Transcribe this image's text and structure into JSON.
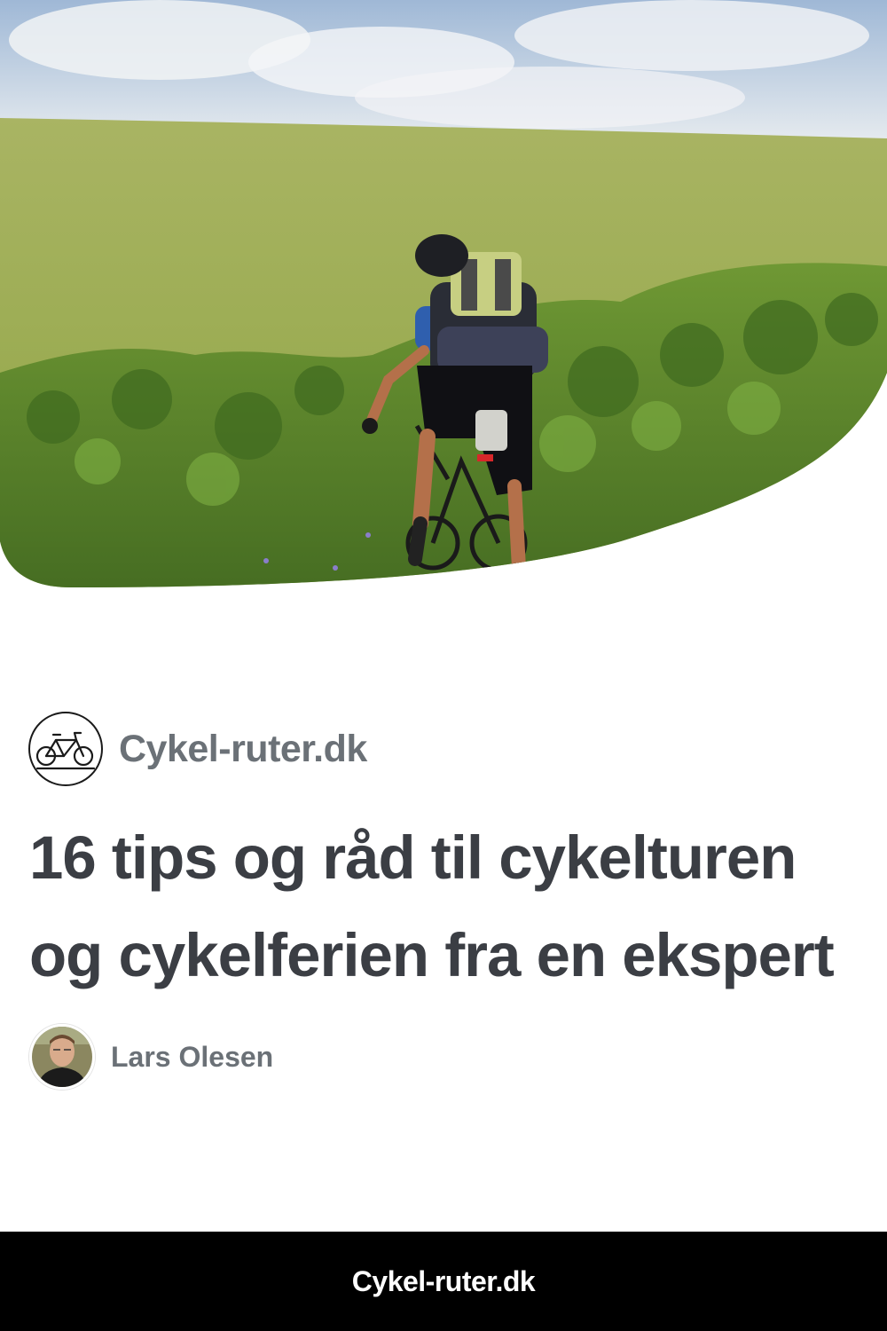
{
  "hero": {
    "image": "cyclist-riding-road-bike-past-green-field",
    "colors": {
      "sky": "#c7d5e3",
      "field": "#9fae55",
      "bushes": "#56802a"
    }
  },
  "brand": {
    "logo_icon": "bicycle-icon",
    "name": "Cykel-ruter.dk"
  },
  "article": {
    "title": "16 tips og råd til cykelturen og cykelferien fra en ekspert"
  },
  "author": {
    "avatar_icon": "author-portrait",
    "name": "Lars Olesen"
  },
  "footer": {
    "site": "Cykel-ruter.dk"
  },
  "colors": {
    "title": "#3b3e44",
    "muted_text": "#6b7177",
    "footer_bg": "#000000",
    "footer_text": "#ffffff"
  }
}
